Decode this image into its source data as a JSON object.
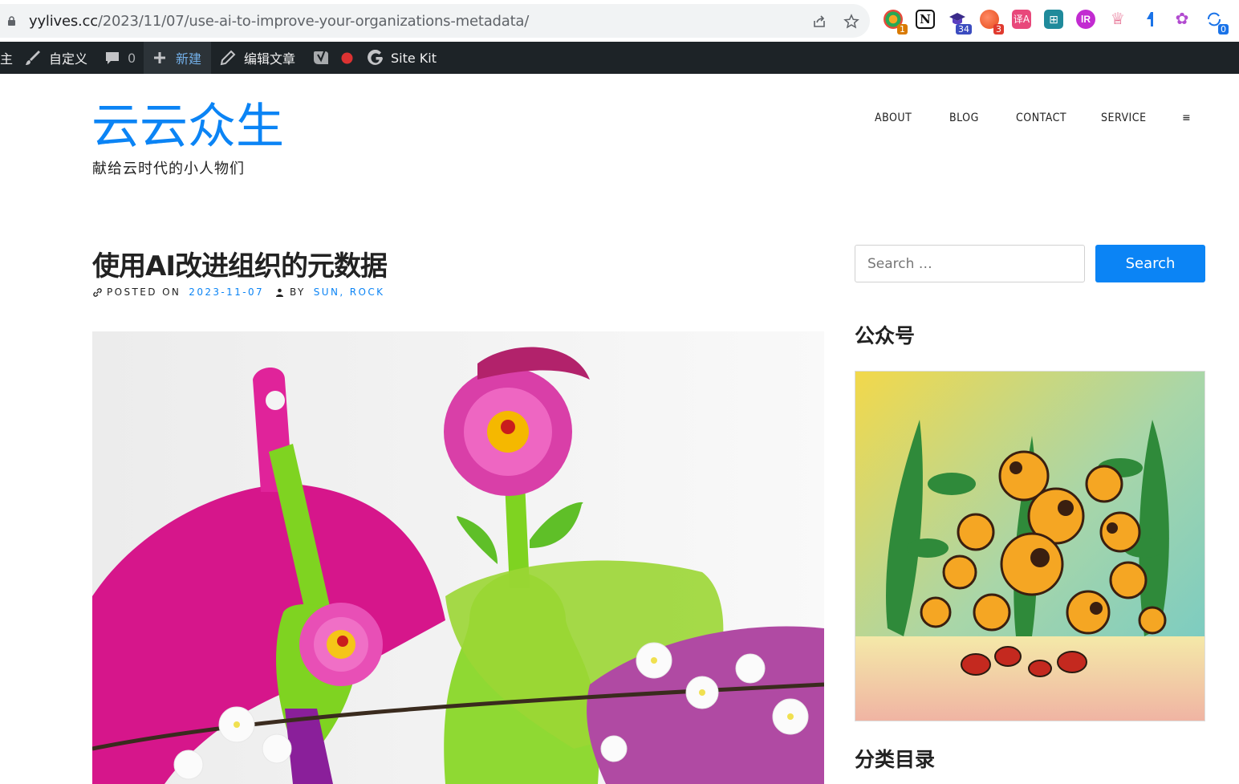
{
  "browser": {
    "url_host": "yylives.cc",
    "url_path": "/2023/11/07/use-ai-to-improve-your-organizations-metadata/",
    "extensions": [
      {
        "name": "extension-1-icon",
        "badge": "1",
        "badge_color": "#d97a00"
      },
      {
        "name": "notion-icon",
        "badge": ""
      },
      {
        "name": "graduation-cap-icon",
        "badge": "34",
        "badge_color": "#3b4cc0"
      },
      {
        "name": "extension-red-icon",
        "badge": "3",
        "badge_color": "#e03a2f"
      },
      {
        "name": "translate-icon",
        "badge": ""
      },
      {
        "name": "puzzle-grid-icon",
        "badge": ""
      },
      {
        "name": "purple-circle-icon",
        "badge": ""
      },
      {
        "name": "crown-icon",
        "badge": ""
      },
      {
        "name": "blue-arrow-icon",
        "badge": ""
      },
      {
        "name": "openai-icon",
        "badge": ""
      },
      {
        "name": "sync-icon",
        "badge": "0",
        "badge_color": "#1a73e8"
      }
    ]
  },
  "adminbar": {
    "site_cut": "主",
    "customize": "自定义",
    "comments_count": "0",
    "new": "新建",
    "edit_post": "编辑文章",
    "sitekit": "Site Kit"
  },
  "site": {
    "title": "云云众生",
    "description": "献给云时代的小人物们"
  },
  "nav": {
    "items": [
      "ABOUT",
      "BLOG",
      "CONTACT",
      "SERVICE"
    ],
    "menu_glyph": "≡"
  },
  "entry": {
    "title": "使用AI改进组织的元数据",
    "posted_on_label": "POSTED ON",
    "date": "2023-11-07",
    "by_label": "BY",
    "authors": "SUN, ROCK"
  },
  "sidebar": {
    "search_placeholder": "Search …",
    "search_button": "Search",
    "widget_wechat": "公众号",
    "widget_categories": "分类目录"
  },
  "colors": {
    "accent": "#0b84f5",
    "adminbar": "#1d2327"
  }
}
